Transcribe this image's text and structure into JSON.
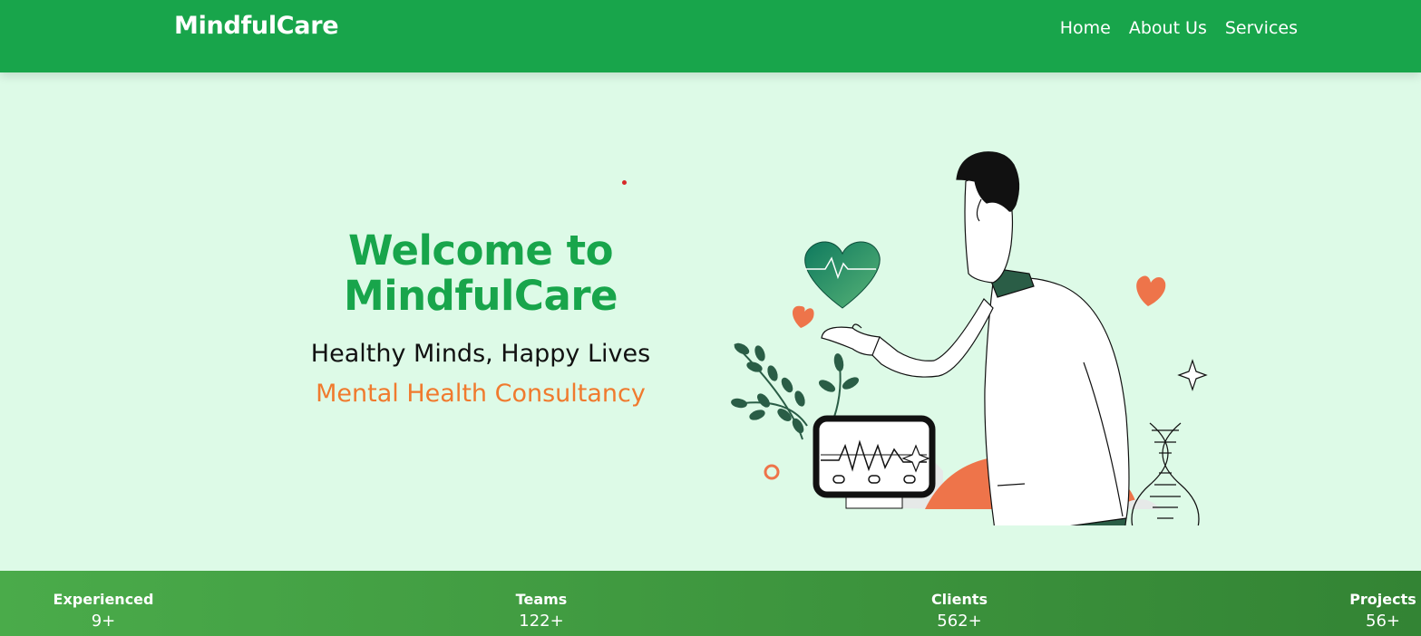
{
  "brand": {
    "name": "MindfulCare"
  },
  "nav": {
    "items": [
      {
        "label": "Home"
      },
      {
        "label": "About Us"
      },
      {
        "label": "Services"
      }
    ]
  },
  "hero": {
    "title": "Welcome to MindfulCare",
    "tagline": "Healthy Minds, Happy Lives",
    "subtitle": "Mental Health Consultancy",
    "illustration": "doctor-with-heart-monitor"
  },
  "stats": [
    {
      "label": "Experienced",
      "value": "9+"
    },
    {
      "label": "Teams",
      "value": "122+"
    },
    {
      "label": "Clients",
      "value": "562+"
    },
    {
      "label": "Projects",
      "value": "56+"
    }
  ],
  "colors": {
    "primary": "#18a54b",
    "background": "#ddfae7",
    "accent": "#f07a2e",
    "stats_gradient_start": "#4aab4a",
    "stats_gradient_end": "#338434",
    "dark_green": "#2a5d46"
  }
}
